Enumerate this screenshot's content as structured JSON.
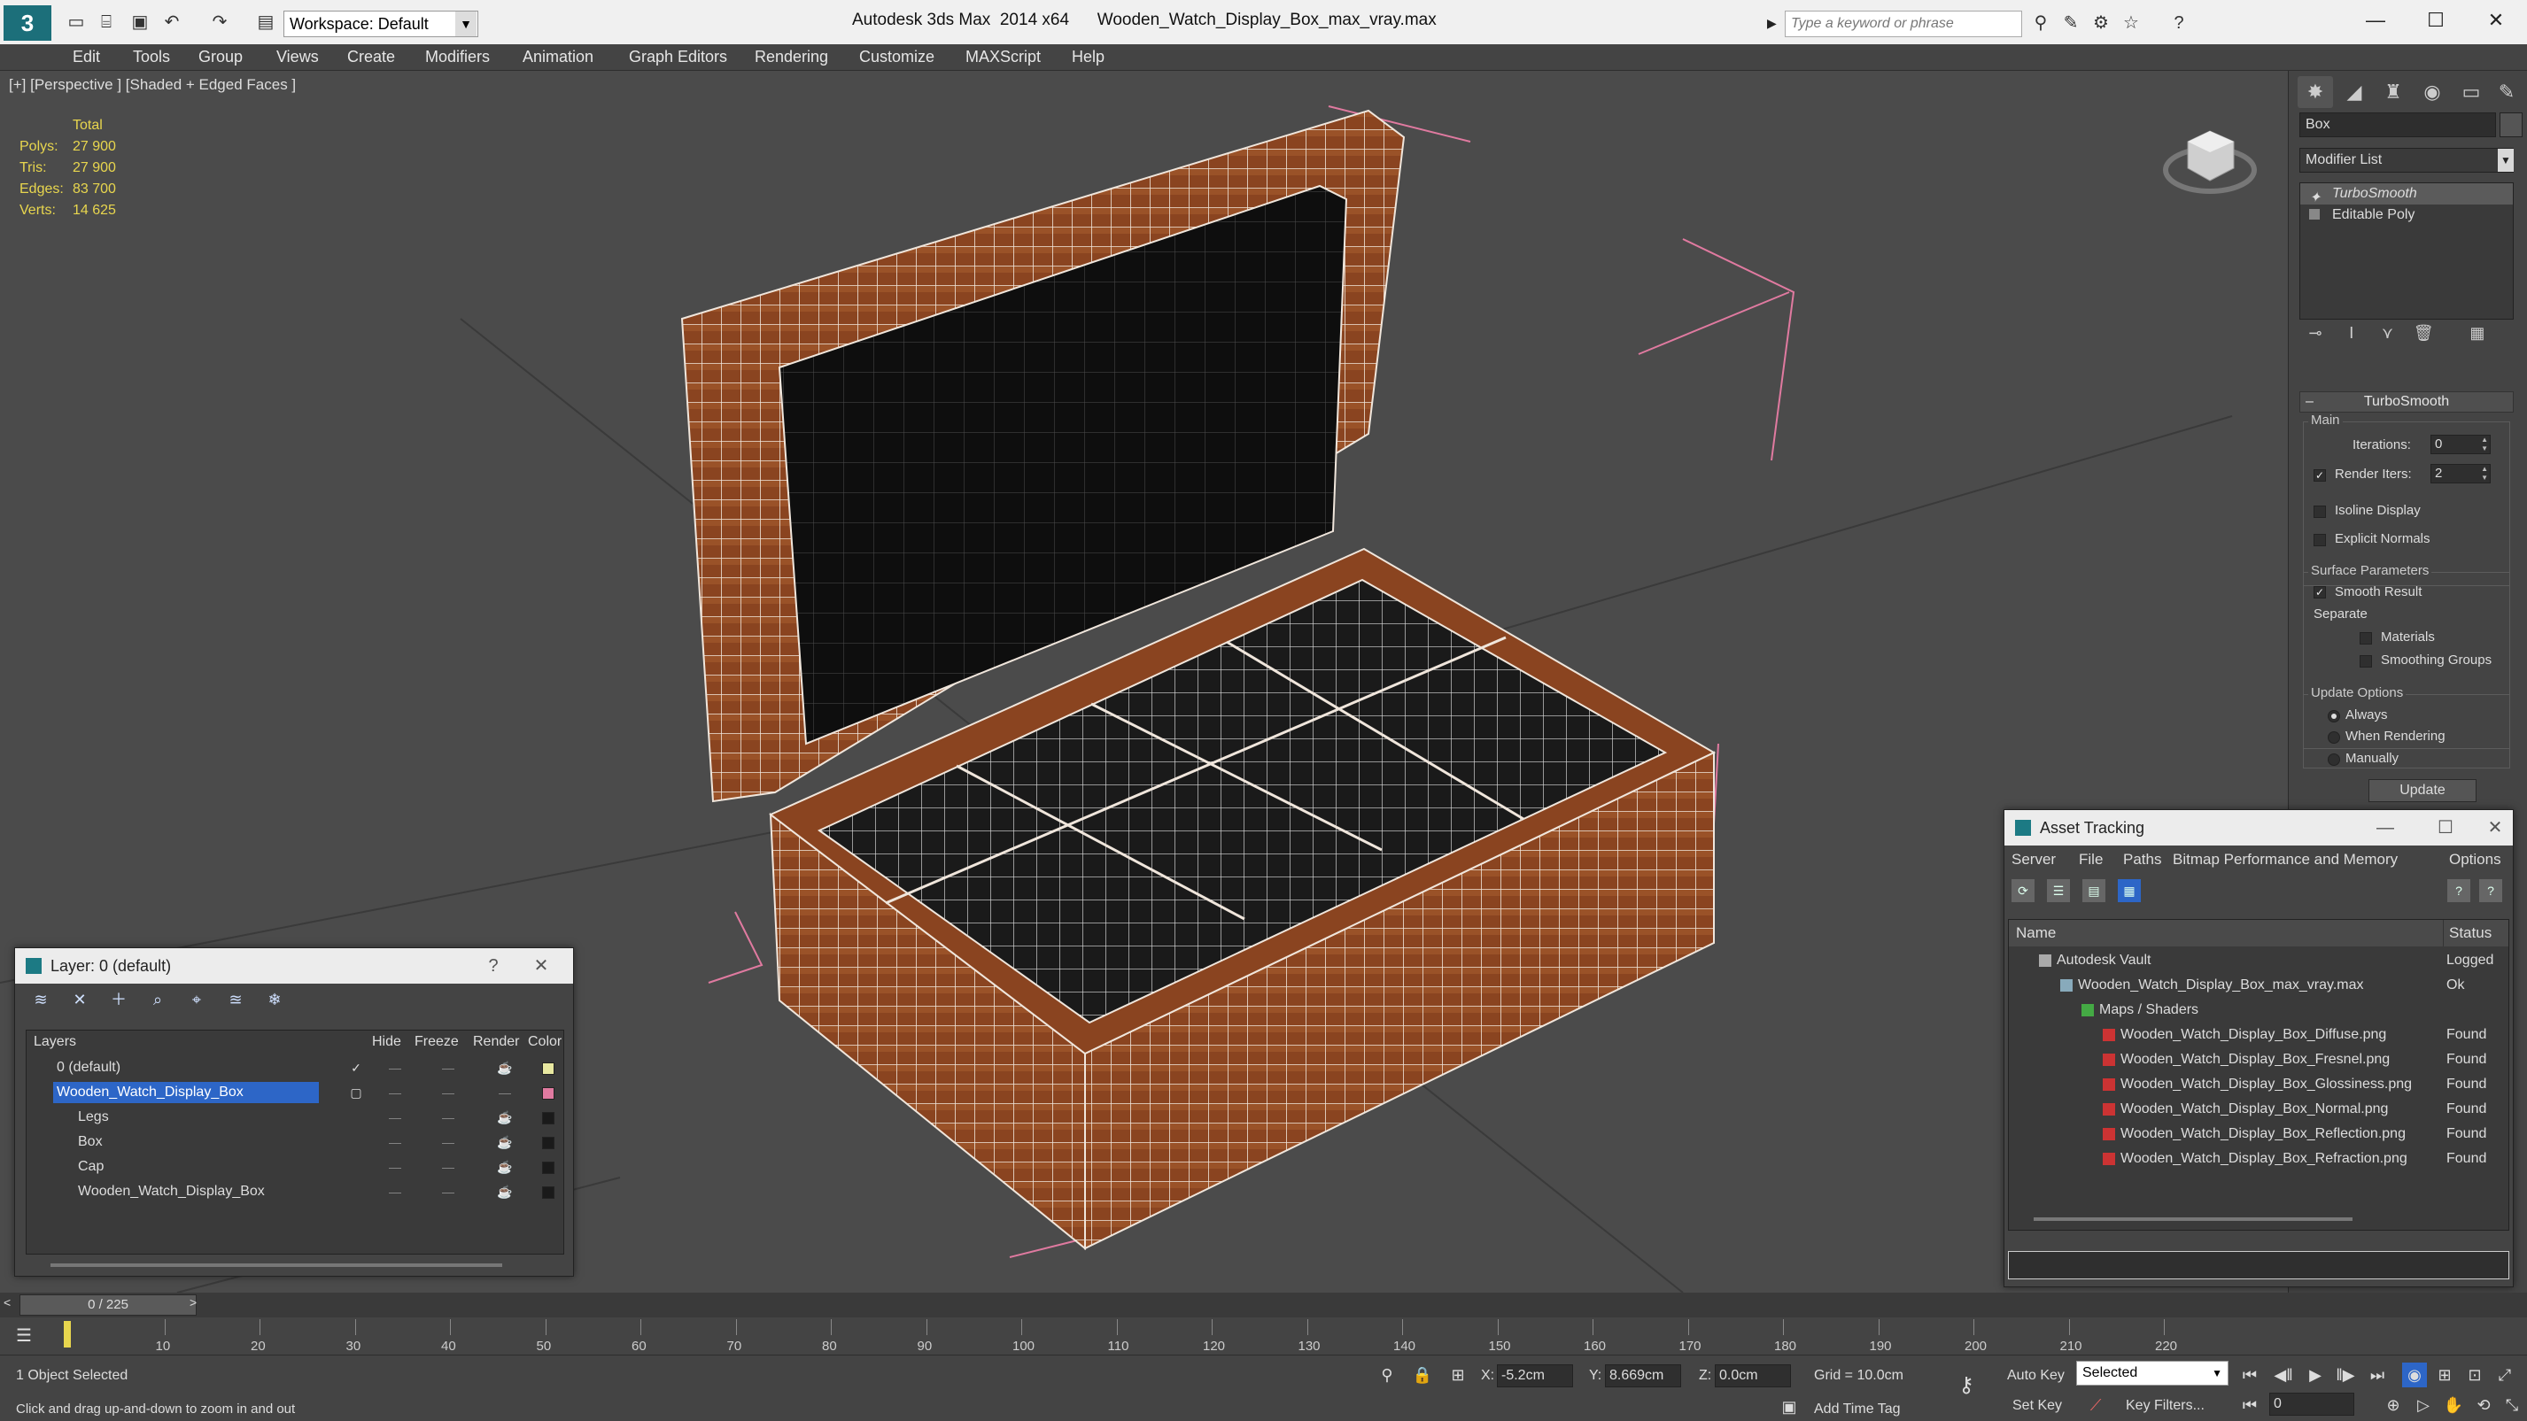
{
  "titlebar": {
    "logo": "3",
    "workspace": "Workspace: Default",
    "app_title": "Autodesk 3ds Max  2014 x64",
    "file_title": "Wooden_Watch_Display_Box_max_vray.max",
    "search_placeholder": "Type a keyword or phrase",
    "minimize": "—",
    "maximize": "☐",
    "close": "✕"
  },
  "menu": [
    "Edit",
    "Tools",
    "Group",
    "Views",
    "Create",
    "Modifiers",
    "Animation",
    "Graph Editors",
    "Rendering",
    "Customize",
    "MAXScript",
    "Help"
  ],
  "viewport": {
    "label": "[+] [Perspective ] [Shaded + Edged Faces ]",
    "stats": {
      "header": "Total",
      "rows": [
        {
          "k": "Polys:",
          "v": "27 900"
        },
        {
          "k": "Tris:",
          "v": "27 900"
        },
        {
          "k": "Edges:",
          "v": "83 700"
        },
        {
          "k": "Verts:",
          "v": "14 625"
        }
      ]
    }
  },
  "command_panel": {
    "object_name": "Box",
    "modifier_list": "Modifier List",
    "stack": [
      {
        "label": "TurboSmooth",
        "selected": true
      },
      {
        "label": "Editable Poly",
        "selected": false
      }
    ],
    "rollout_title": "TurboSmooth",
    "main_label": "Main",
    "iterations_label": "Iterations:",
    "iterations_value": "0",
    "render_iters_label": "Render Iters:",
    "render_iters_value": "2",
    "isoline_label": "Isoline Display",
    "explicit_normals_label": "Explicit Normals",
    "surface_params_label": "Surface Parameters",
    "smooth_result_label": "Smooth Result",
    "separate_label": "Separate",
    "materials_label": "Materials",
    "smoothing_groups_label": "Smoothing Groups",
    "update_options_label": "Update Options",
    "always_label": "Always",
    "when_rendering_label": "When Rendering",
    "manually_label": "Manually",
    "update_button": "Update"
  },
  "layer_window": {
    "title": "Layer: 0 (default)",
    "help": "?",
    "close": "✕",
    "columns": {
      "layers": "Layers",
      "hide": "Hide",
      "freeze": "Freeze",
      "render": "Render",
      "color": "Color"
    },
    "rows": [
      {
        "name": "0 (default)",
        "indent": 1,
        "selected": false,
        "color": "#e8e8a0"
      },
      {
        "name": "Wooden_Watch_Display_Box",
        "indent": 1,
        "selected": true,
        "color": "#e07aa0"
      },
      {
        "name": "Legs",
        "indent": 2,
        "selected": false,
        "color": "#1a1a1a"
      },
      {
        "name": "Box",
        "indent": 2,
        "selected": false,
        "color": "#1a1a1a"
      },
      {
        "name": "Cap",
        "indent": 2,
        "selected": false,
        "color": "#1a1a1a"
      },
      {
        "name": "Wooden_Watch_Display_Box",
        "indent": 2,
        "selected": false,
        "color": "#1a1a1a"
      }
    ]
  },
  "asset_window": {
    "title": "Asset Tracking",
    "menu": [
      "Server",
      "File",
      "Paths",
      "Bitmap Performance and Memory",
      "Options"
    ],
    "col_name": "Name",
    "col_status": "Status",
    "rows": [
      {
        "name": "Autodesk Vault",
        "indent": 1,
        "status": "Logged",
        "icon": "vault"
      },
      {
        "name": "Wooden_Watch_Display_Box_max_vray.max",
        "indent": 2,
        "status": "Ok",
        "icon": "max"
      },
      {
        "name": "Maps / Shaders",
        "indent": 3,
        "status": "",
        "icon": "folder"
      },
      {
        "name": "Wooden_Watch_Display_Box_Diffuse.png",
        "indent": 4,
        "status": "Found",
        "icon": "png"
      },
      {
        "name": "Wooden_Watch_Display_Box_Fresnel.png",
        "indent": 4,
        "status": "Found",
        "icon": "png"
      },
      {
        "name": "Wooden_Watch_Display_Box_Glossiness.png",
        "indent": 4,
        "status": "Found",
        "icon": "png"
      },
      {
        "name": "Wooden_Watch_Display_Box_Normal.png",
        "indent": 4,
        "status": "Found",
        "icon": "png"
      },
      {
        "name": "Wooden_Watch_Display_Box_Reflection.png",
        "indent": 4,
        "status": "Found",
        "icon": "png"
      },
      {
        "name": "Wooden_Watch_Display_Box_Refraction.png",
        "indent": 4,
        "status": "Found",
        "icon": "png"
      }
    ]
  },
  "timeline": {
    "frame_display": "0 / 225",
    "ticks": [
      "10",
      "20",
      "30",
      "40",
      "50",
      "60",
      "70",
      "80",
      "90",
      "100",
      "110",
      "120",
      "130",
      "140",
      "150",
      "160",
      "170",
      "180",
      "190",
      "200",
      "210",
      "220"
    ]
  },
  "status": {
    "selection": "1 Object Selected",
    "prompt": "Click and drag up-and-down to zoom in and out",
    "x_label": "X:",
    "x_value": "-5.2cm",
    "y_label": "Y:",
    "y_value": "8.669cm",
    "z_label": "Z:",
    "z_value": "0.0cm",
    "grid": "Grid = 10.0cm",
    "add_time_tag": "Add Time Tag",
    "auto_key": "Auto Key",
    "set_key": "Set Key",
    "selected_mode": "Selected",
    "key_filters": "Key Filters...",
    "frame": "0"
  },
  "colors": {
    "stats_yellow": "#e8d64e",
    "selection_blue": "#2d66c7",
    "wood": "#8a4420",
    "bbox_pink": "#e07aa0"
  }
}
